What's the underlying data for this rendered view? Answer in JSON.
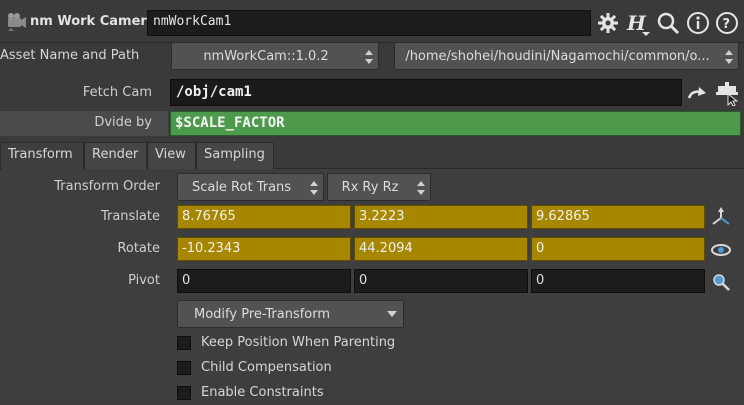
{
  "header": {
    "node_type": "nm Work Camera",
    "node_name": "nmWorkCam1",
    "icons": [
      "node-type-icon",
      "gear-icon",
      "houdini-help-icon",
      "search-icon",
      "info-icon",
      "help-icon"
    ]
  },
  "asset": {
    "label": "Asset Name and Path",
    "name": "nmWorkCam::1.0.2",
    "path": "/home/shohei/houdini/Nagamochi/common/o..."
  },
  "fetch_cam": {
    "label": "Fetch Cam",
    "value": "/obj/cam1"
  },
  "dvide_by": {
    "label": "Dvide by",
    "value": "$SCALE_FACTOR"
  },
  "tabs": [
    {
      "label": "Transform",
      "active": true
    },
    {
      "label": "Render",
      "active": false
    },
    {
      "label": "View",
      "active": false
    },
    {
      "label": "Sampling",
      "active": false
    }
  ],
  "transform": {
    "order_label": "Transform Order",
    "order_value": "Scale Rot Trans",
    "rot_order_value": "Rx Ry Rz",
    "translate": {
      "label": "Translate",
      "values": [
        "8.76765",
        "3.2223",
        "9.62865"
      ]
    },
    "rotate": {
      "label": "Rotate",
      "values": [
        "-10.2343",
        "44.2094",
        "0"
      ]
    },
    "pivot": {
      "label": "Pivot",
      "values": [
        "0",
        "0",
        "0"
      ]
    },
    "modify_menu": "Modify Pre-Transform",
    "checkboxes": [
      {
        "label": "Keep Position When Parenting",
        "checked": false
      },
      {
        "label": "Child Compensation",
        "checked": false
      },
      {
        "label": "Enable Constraints",
        "checked": false
      }
    ]
  },
  "colors": {
    "animated_field": "#a88700",
    "expression_field": "#4d9a4d",
    "background": "#3a3a3a"
  }
}
